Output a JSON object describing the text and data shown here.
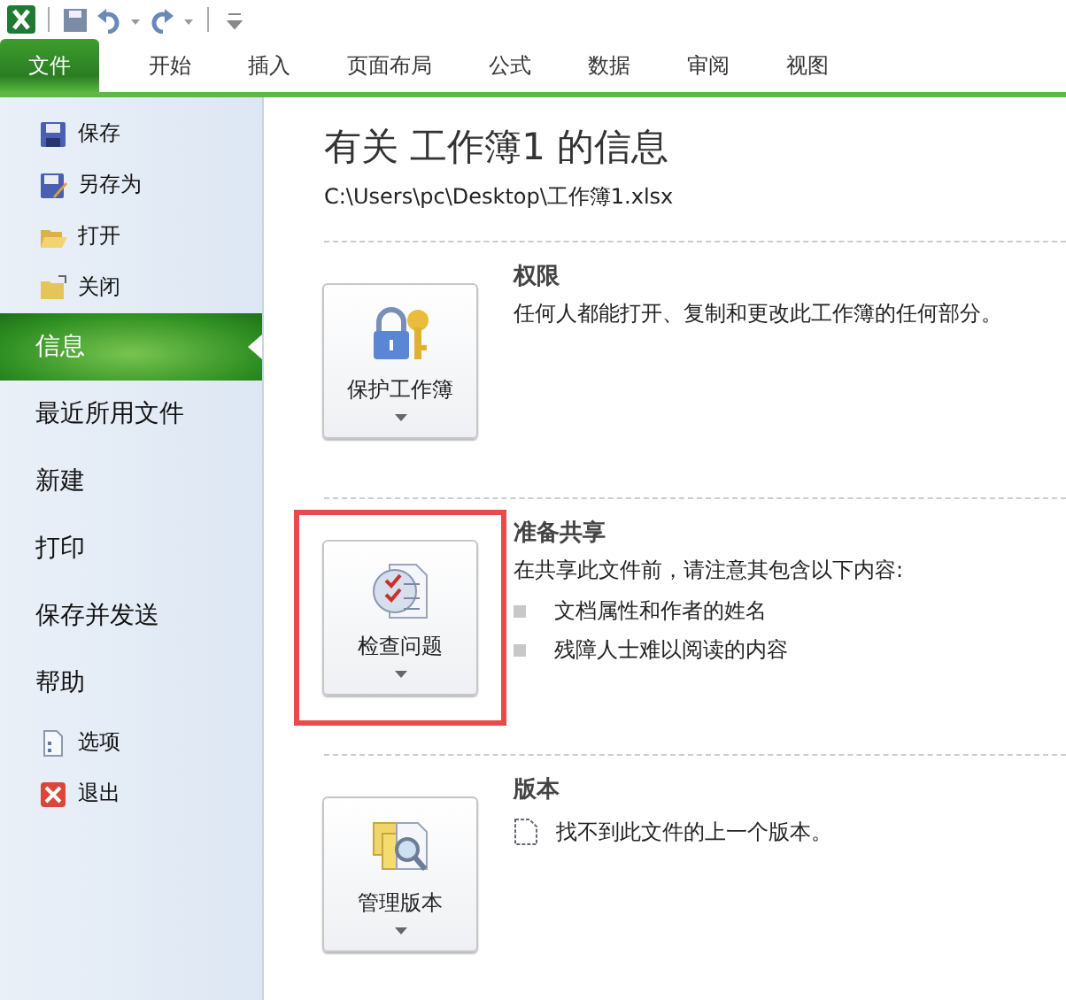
{
  "quick_access": {
    "items": [
      {
        "kind": "save"
      },
      {
        "kind": "undo"
      },
      {
        "kind": "redo"
      },
      {
        "kind": "customize"
      }
    ]
  },
  "ribbon_tabs": [
    {
      "label": "文件",
      "kind": "file",
      "selected": true
    },
    {
      "label": "开始",
      "kind": "tab",
      "selected": false
    },
    {
      "label": "插入",
      "kind": "tab",
      "selected": false
    },
    {
      "label": "页面布局",
      "kind": "tab",
      "selected": false
    },
    {
      "label": "公式",
      "kind": "tab",
      "selected": false
    },
    {
      "label": "数据",
      "kind": "tab",
      "selected": false
    },
    {
      "label": "审阅",
      "kind": "tab",
      "selected": false
    },
    {
      "label": "视图",
      "kind": "tab",
      "selected": false
    }
  ],
  "sidebar": {
    "items": [
      {
        "label": "保存",
        "kind": "command",
        "selected": false
      },
      {
        "label": "另存为",
        "kind": "command",
        "selected": false
      },
      {
        "label": "打开",
        "kind": "command",
        "selected": false
      },
      {
        "label": "关闭",
        "kind": "command",
        "selected": false
      },
      {
        "label": "信息",
        "kind": "page",
        "selected": true
      },
      {
        "label": "最近所用文件",
        "kind": "page",
        "selected": false
      },
      {
        "label": "新建",
        "kind": "page",
        "selected": false
      },
      {
        "label": "打印",
        "kind": "page",
        "selected": false
      },
      {
        "label": "保存并发送",
        "kind": "page",
        "selected": false
      },
      {
        "label": "帮助",
        "kind": "page",
        "selected": false
      },
      {
        "label": "选项",
        "kind": "command",
        "selected": false
      },
      {
        "label": "退出",
        "kind": "command",
        "selected": false
      }
    ]
  },
  "info": {
    "title": "有关 工作簿1 的信息",
    "path": "C:\\Users\\pc\\Desktop\\工作簿1.xlsx",
    "sections": [
      {
        "button": "保护工作簿",
        "heading": "权限",
        "description": "任何人都能打开、复制和更改此工作簿的任何部分。",
        "highlighted": false
      },
      {
        "button": "检查问题",
        "heading": "准备共享",
        "description": "在共享此文件前，请注意其包含以下内容:",
        "bullets": [
          "文档属性和作者的姓名",
          "残障人士难以阅读的内容"
        ],
        "highlighted": true
      },
      {
        "button": "管理版本",
        "heading": "版本",
        "note": "找不到此文件的上一个版本。",
        "highlighted": false
      }
    ]
  }
}
